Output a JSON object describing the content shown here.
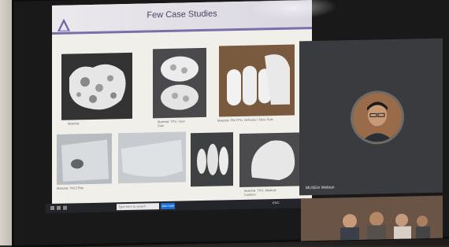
{
  "slide": {
    "title": "Few Case Studies",
    "captions": [
      {
        "text": "Material:",
        "sub": ""
      },
      {
        "text": "Material: TPU, Foot",
        "sub": "Sole"
      },
      {
        "text": "Material: PM-TPU, Orthosis / Shoe Sole",
        "sub": ""
      },
      {
        "text": "Material: PA12 Bite",
        "sub": ""
      },
      {
        "text": "",
        "sub": ""
      },
      {
        "text": "",
        "sub": ""
      },
      {
        "text": "Material: TPU, Medical",
        "sub": "Cushion"
      }
    ]
  },
  "taskbar": {
    "search_placeholder": "Type here to search",
    "button_label": "Join now",
    "clock": "ENG"
  },
  "meeting": {
    "participant_name": "MUSEin Webian"
  }
}
